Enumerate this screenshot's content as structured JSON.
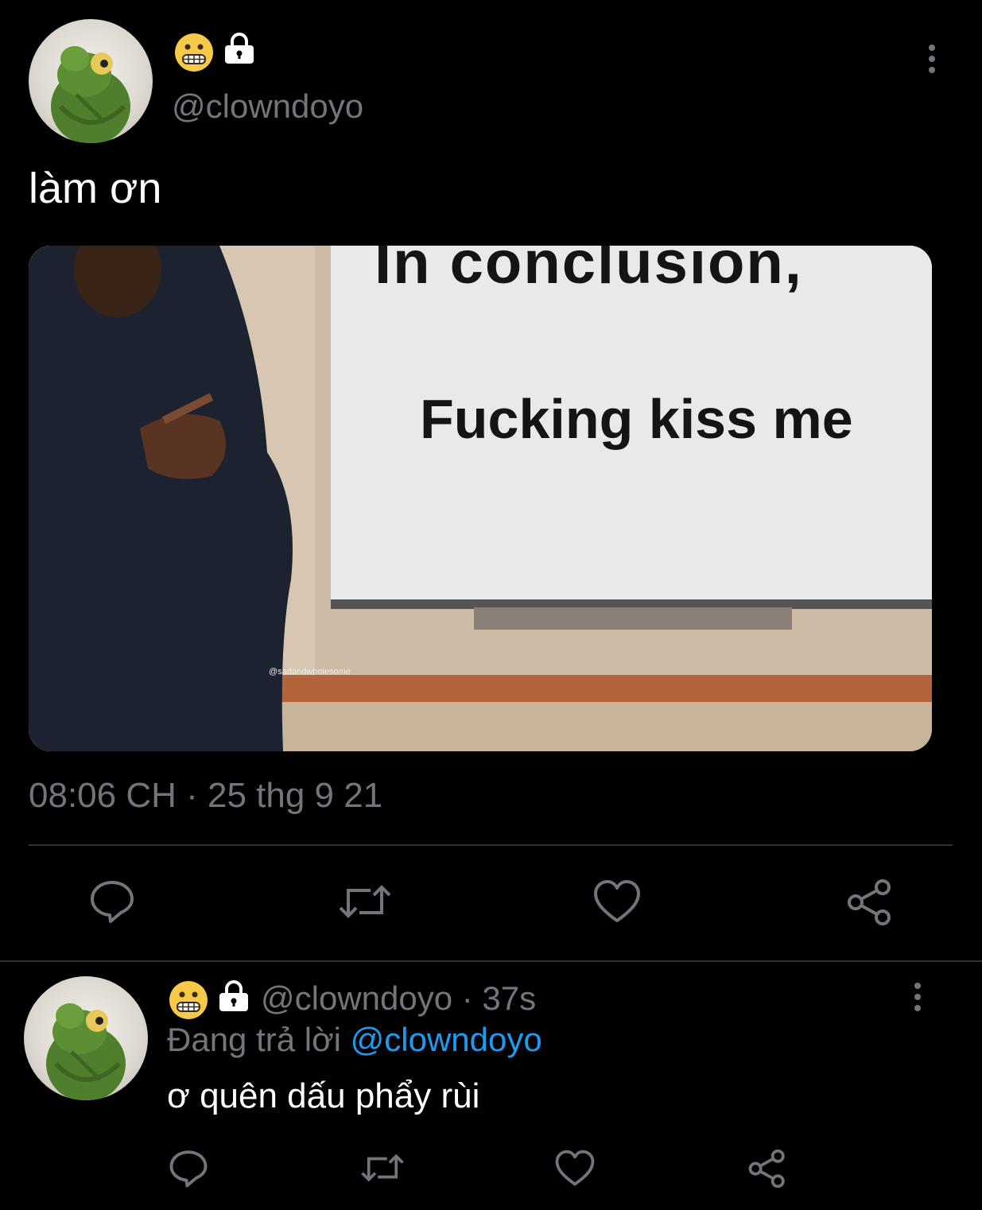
{
  "tweet": {
    "emoji": "😬",
    "handle": "@clowndoyo",
    "text": "làm ơn",
    "media": {
      "headline": "In conclusion,",
      "caption": "Fucking kiss me",
      "watermark": "@sadandwholesome"
    },
    "timestamp": "08:06 CH · 25 thg 9 21"
  },
  "actions": [
    "reply-icon",
    "retweet-icon",
    "like-icon",
    "share-icon"
  ],
  "reply": {
    "emoji": "😬",
    "handle": "@clowndoyo",
    "time": "· 37s",
    "replying_label": "Đang trả lời",
    "replying_to": "@clowndoyo",
    "text": "ơ quên dấu phẩy rùi"
  },
  "colors": {
    "background": "#000000",
    "text": "#e7e9ea",
    "muted": "#71767b",
    "link": "#1d9bf0",
    "divider": "#2f3336"
  }
}
